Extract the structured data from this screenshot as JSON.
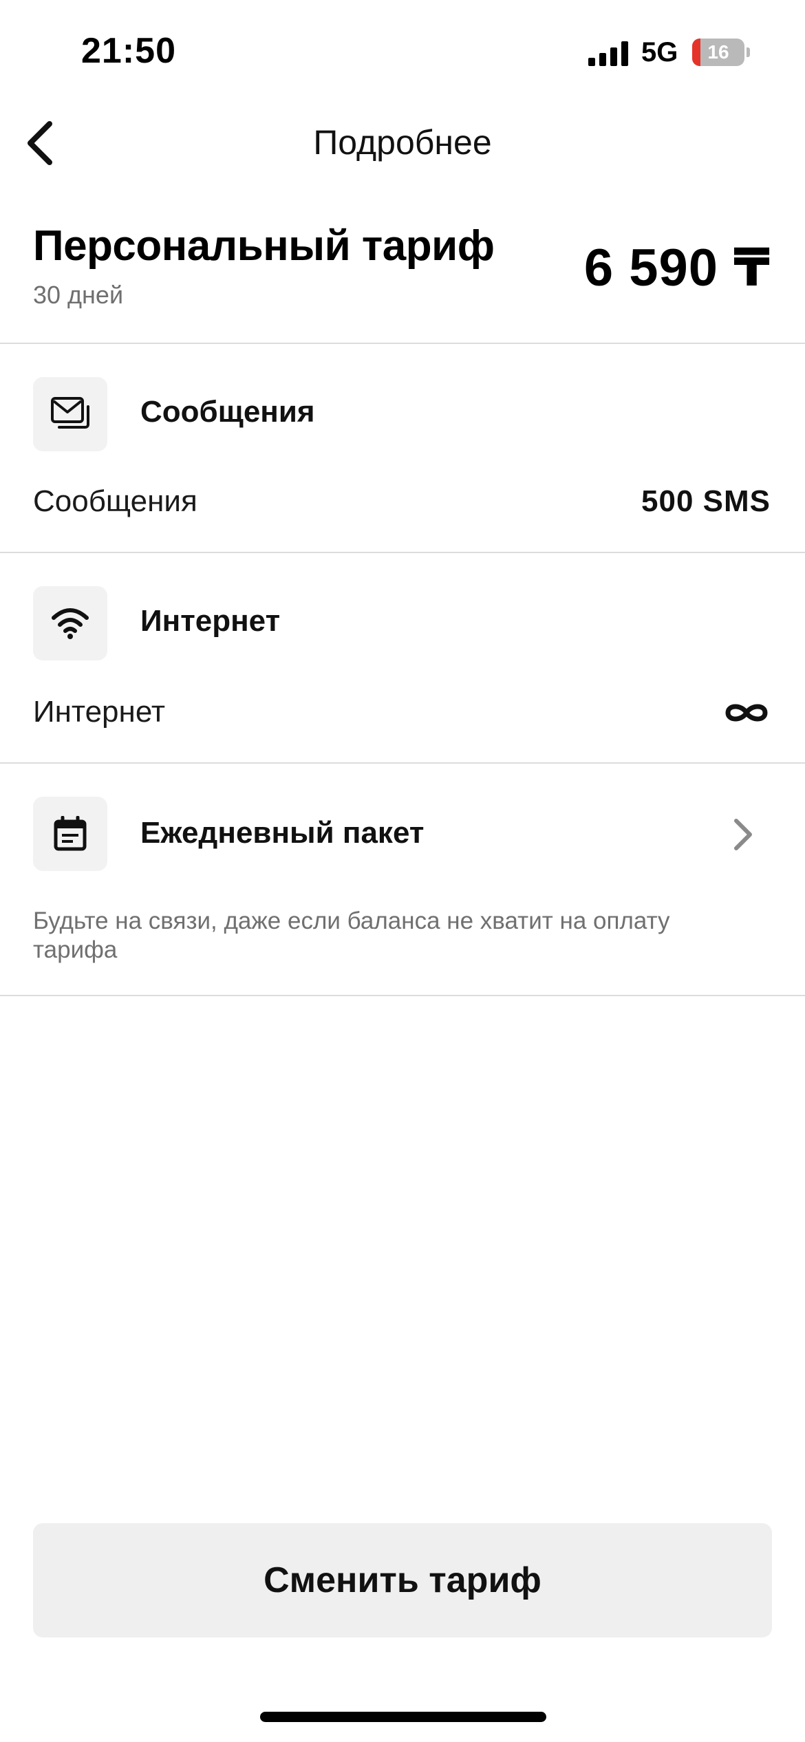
{
  "status_bar": {
    "time": "21:50",
    "network": "5G",
    "battery_percent": "16",
    "battery_level": 0.16,
    "icons": [
      "signal-icon",
      "battery-icon"
    ]
  },
  "nav": {
    "title": "Подробнее",
    "back_icon": "chevron-left-icon"
  },
  "tariff": {
    "name": "Персональный тариф",
    "period": "30 дней",
    "price": "6 590 ₸"
  },
  "sections": {
    "messages": {
      "icon": "messages-icon",
      "title": "Сообщения",
      "row_label": "Сообщения",
      "row_value": "500 SMS"
    },
    "internet": {
      "icon": "wifi-icon",
      "title": "Интернет",
      "row_label": "Интернет",
      "row_value_icon": "infinity-icon"
    },
    "daily_package": {
      "icon": "calendar-icon",
      "title": "Ежедневный пакет",
      "note": "Будьте на связи, даже если баланса не хватит на оплату тарифа",
      "chevron_icon": "chevron-right-icon"
    }
  },
  "actions": {
    "change_tariff_label": "Сменить тариф"
  },
  "colors": {
    "text": "#111111",
    "secondary_text": "#707070",
    "divider": "#dcdcdc",
    "icon_bg": "#f2f2f2",
    "button_bg": "#efefef",
    "battery_low": "#e5332a"
  }
}
